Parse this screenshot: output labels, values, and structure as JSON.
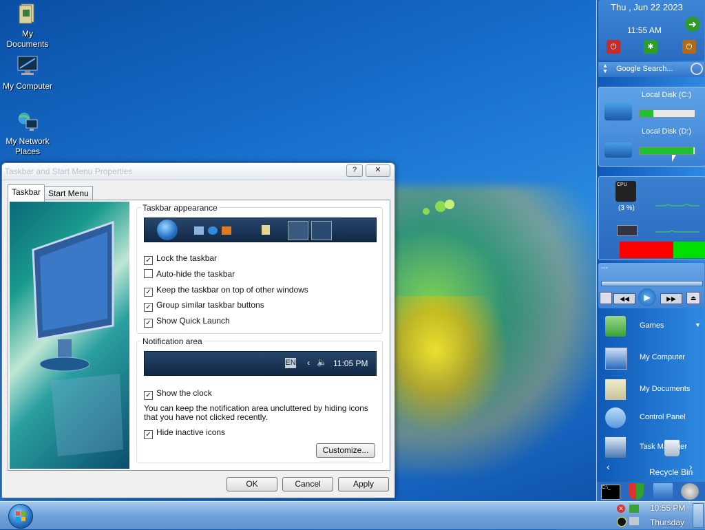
{
  "desktop": {
    "icons": [
      {
        "label": "My Documents"
      },
      {
        "label": "My Computer"
      },
      {
        "label": "My Network Places"
      }
    ]
  },
  "dialog": {
    "title": "Taskbar and Start Menu Properties",
    "help_button": "?",
    "close_button": "✕",
    "tabs": [
      {
        "label": "Taskbar",
        "active": true
      },
      {
        "label": "Start Menu",
        "active": false
      }
    ],
    "taskbar_appearance": {
      "label": "Taskbar appearance",
      "options": [
        {
          "label": "Lock the taskbar",
          "checked": true
        },
        {
          "label": "Auto-hide the taskbar",
          "checked": false
        },
        {
          "label": "Keep the taskbar on top of other windows",
          "checked": true
        },
        {
          "label": "Group similar taskbar buttons",
          "checked": true
        },
        {
          "label": "Show Quick Launch",
          "checked": true
        }
      ]
    },
    "notification_area": {
      "label": "Notification area",
      "preview_lang": "EN",
      "preview_time": "11:05 PM",
      "show_clock": {
        "label": "Show the clock",
        "checked": true
      },
      "description": "You can keep the notification area uncluttered by hiding icons that you have not clicked recently.",
      "hide_inactive": {
        "label": "Hide inactive icons",
        "checked": true
      },
      "customize_button": "Customize..."
    },
    "buttons": {
      "ok": "OK",
      "cancel": "Cancel",
      "apply": "Apply"
    }
  },
  "sidebar": {
    "date": "Thu , Jun 22 2023",
    "time": "11:55 AM",
    "search_placeholder": "Google Search...",
    "disks": [
      {
        "label": "Local Disk (C:)",
        "used_fraction": 0.25
      },
      {
        "label": "Local Disk (D:)",
        "used_fraction": 0.98
      }
    ],
    "cpu": {
      "label": "CPU",
      "percent_text": "(3 %)"
    },
    "media_title": "---",
    "menu_items": [
      {
        "label": "Games"
      },
      {
        "label": "My Computer"
      },
      {
        "label": "My Documents"
      },
      {
        "label": "Control Panel"
      },
      {
        "label": "Task Manager"
      },
      {
        "label": "Recycle Bin"
      }
    ]
  },
  "taskbar": {
    "clock_time": "10:55 PM",
    "clock_day": "Thursday"
  },
  "colors": {
    "accent": "#1b74d2",
    "disk_green": "#22c030",
    "ram_red": "#ff0000",
    "ram_green": "#00e000"
  }
}
